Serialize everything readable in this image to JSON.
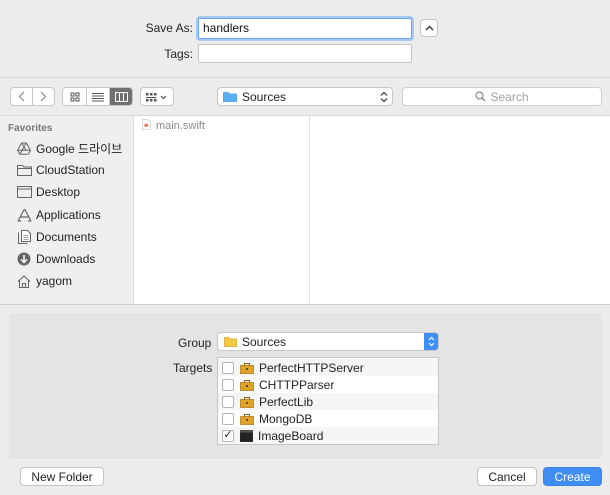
{
  "save": {
    "save_as_label": "Save As:",
    "filename": "handlers",
    "tags_label": "Tags:",
    "tags_value": ""
  },
  "toolbar": {
    "location": "Sources",
    "search_placeholder": "Search"
  },
  "sidebar": {
    "title": "Favorites",
    "items": [
      {
        "label": "Google 드라이브",
        "icon": "google-drive-icon"
      },
      {
        "label": "CloudStation",
        "icon": "folder-icon"
      },
      {
        "label": "Desktop",
        "icon": "desktop-icon"
      },
      {
        "label": "Applications",
        "icon": "applications-icon"
      },
      {
        "label": "Documents",
        "icon": "documents-icon"
      },
      {
        "label": "Downloads",
        "icon": "downloads-icon"
      },
      {
        "label": "yagom",
        "icon": "home-icon"
      }
    ]
  },
  "files": [
    {
      "name": "main.swift",
      "icon": "swift-file-icon"
    }
  ],
  "options": {
    "group_label": "Group",
    "group_value": "Sources",
    "targets_label": "Targets",
    "targets": [
      {
        "name": "PerfectHTTPServer",
        "checked": false,
        "icon": "toolbox-icon"
      },
      {
        "name": "CHTTPParser",
        "checked": false,
        "icon": "toolbox-icon"
      },
      {
        "name": "PerfectLib",
        "checked": false,
        "icon": "toolbox-icon"
      },
      {
        "name": "MongoDB",
        "checked": false,
        "icon": "toolbox-icon"
      },
      {
        "name": "ImageBoard",
        "checked": true,
        "icon": "terminal-icon",
        "check_mark": "✓"
      }
    ]
  },
  "buttons": {
    "new_folder": "New Folder",
    "cancel": "Cancel",
    "create": "Create"
  },
  "colors": {
    "accent": "#3f8ef5",
    "folder": "#5aaef2",
    "toolbox": "#e0a32a"
  }
}
